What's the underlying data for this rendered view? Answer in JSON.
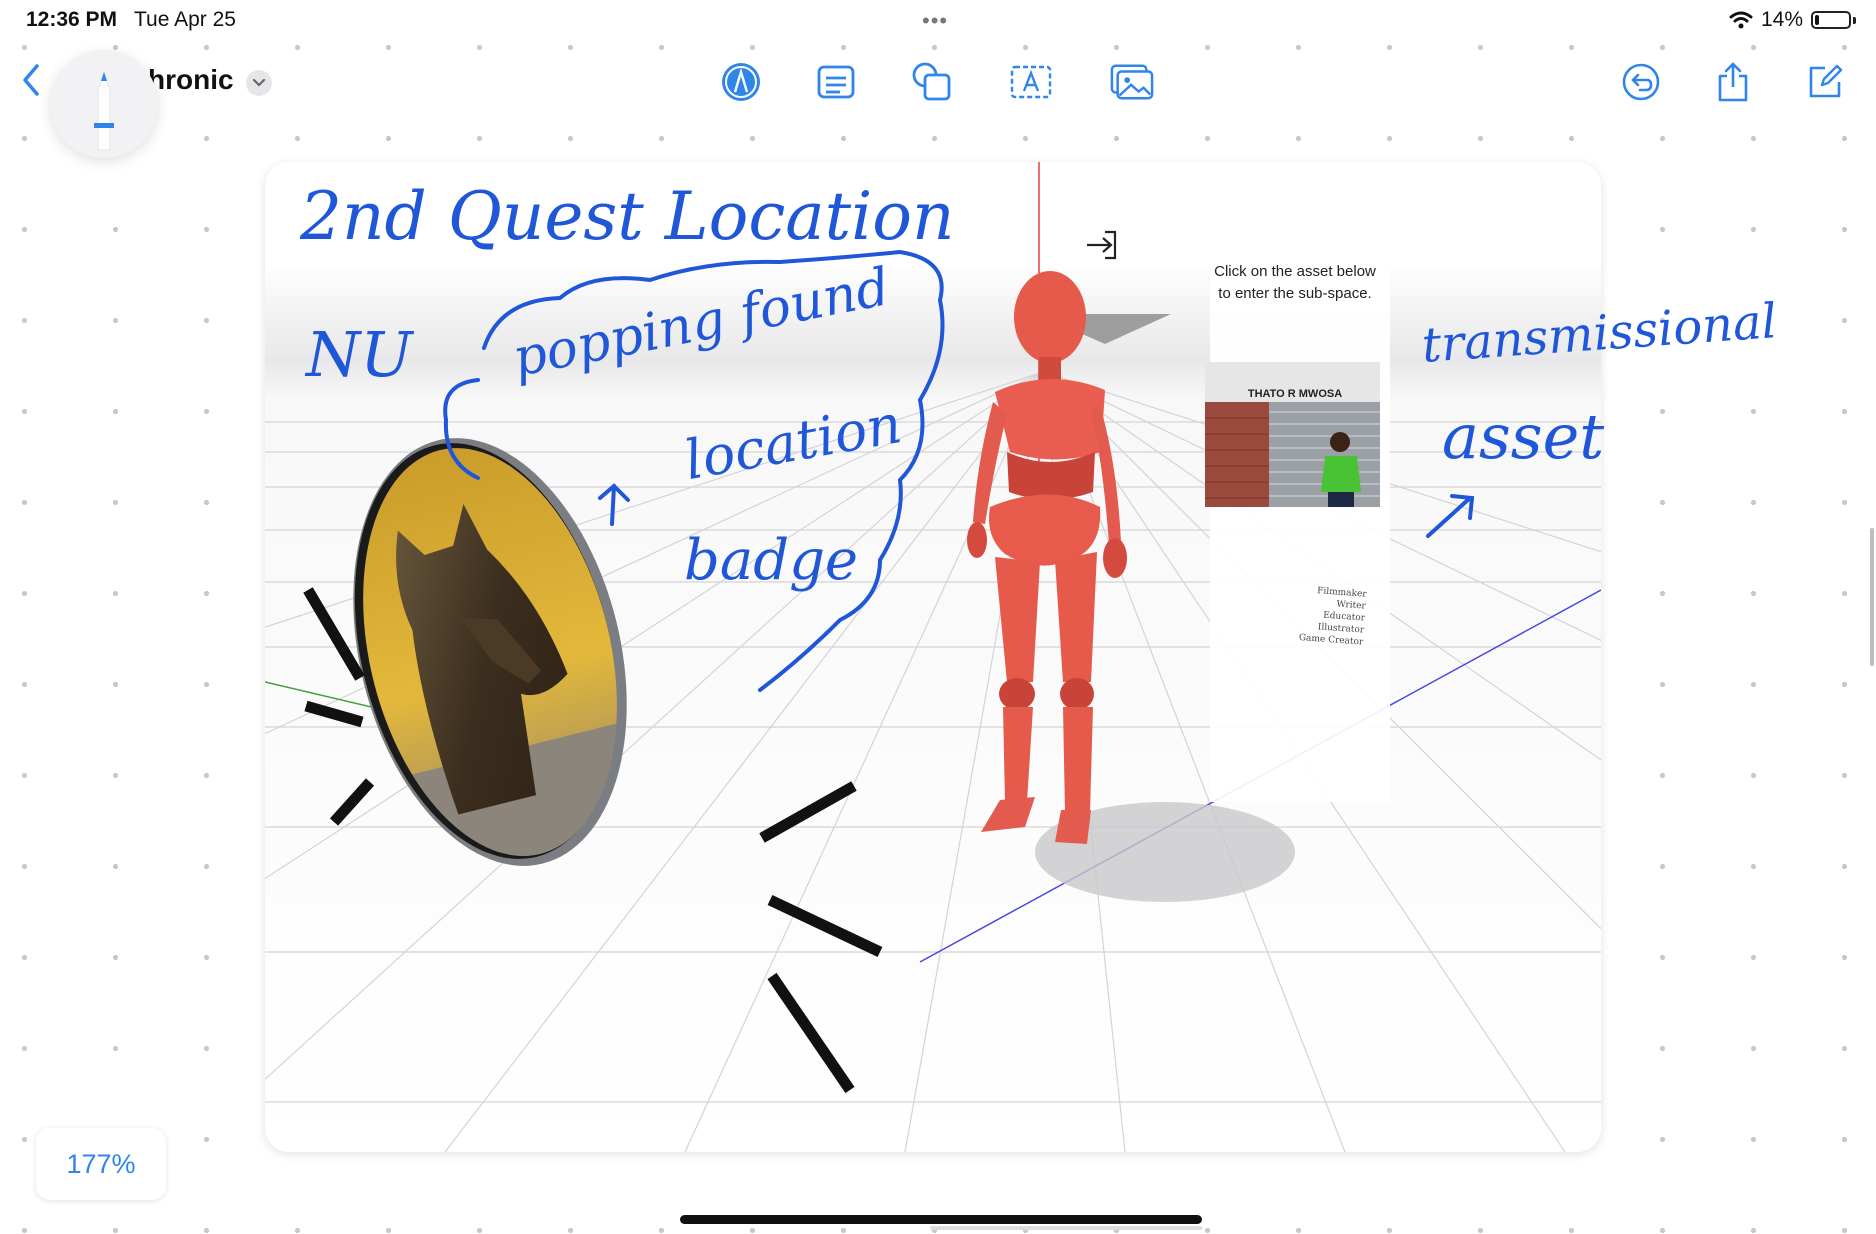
{
  "status": {
    "time": "12:36 PM",
    "date": "Tue Apr 25",
    "dots": "•••",
    "battery_percent": "14%",
    "battery_level": 0.14
  },
  "toolbar": {
    "title": "hronic",
    "tools": [
      "pencil-tool-icon",
      "note-icon",
      "shapes-icon",
      "text-box-icon",
      "media-icon"
    ],
    "right_tools": [
      "undo-icon",
      "share-icon",
      "compose-icon"
    ]
  },
  "accent_color": "#2f86e8",
  "ink_color": "#1f57d8",
  "board": {
    "zoom": "177%",
    "asset_panel": {
      "line1": "Click on the asset below",
      "line2": "to enter the sub-space.",
      "asset_title": "THATO R MWOSA",
      "roles": [
        "Filmmaker",
        "Writer",
        "Educator",
        "Illustrator",
        "Game Creator"
      ]
    },
    "annotations": {
      "title": "2nd Quest Location",
      "nu": "NU",
      "popping": "popping found",
      "location": "location",
      "badge": "badge",
      "transmissional": "transmissional",
      "asset": "asset"
    }
  }
}
